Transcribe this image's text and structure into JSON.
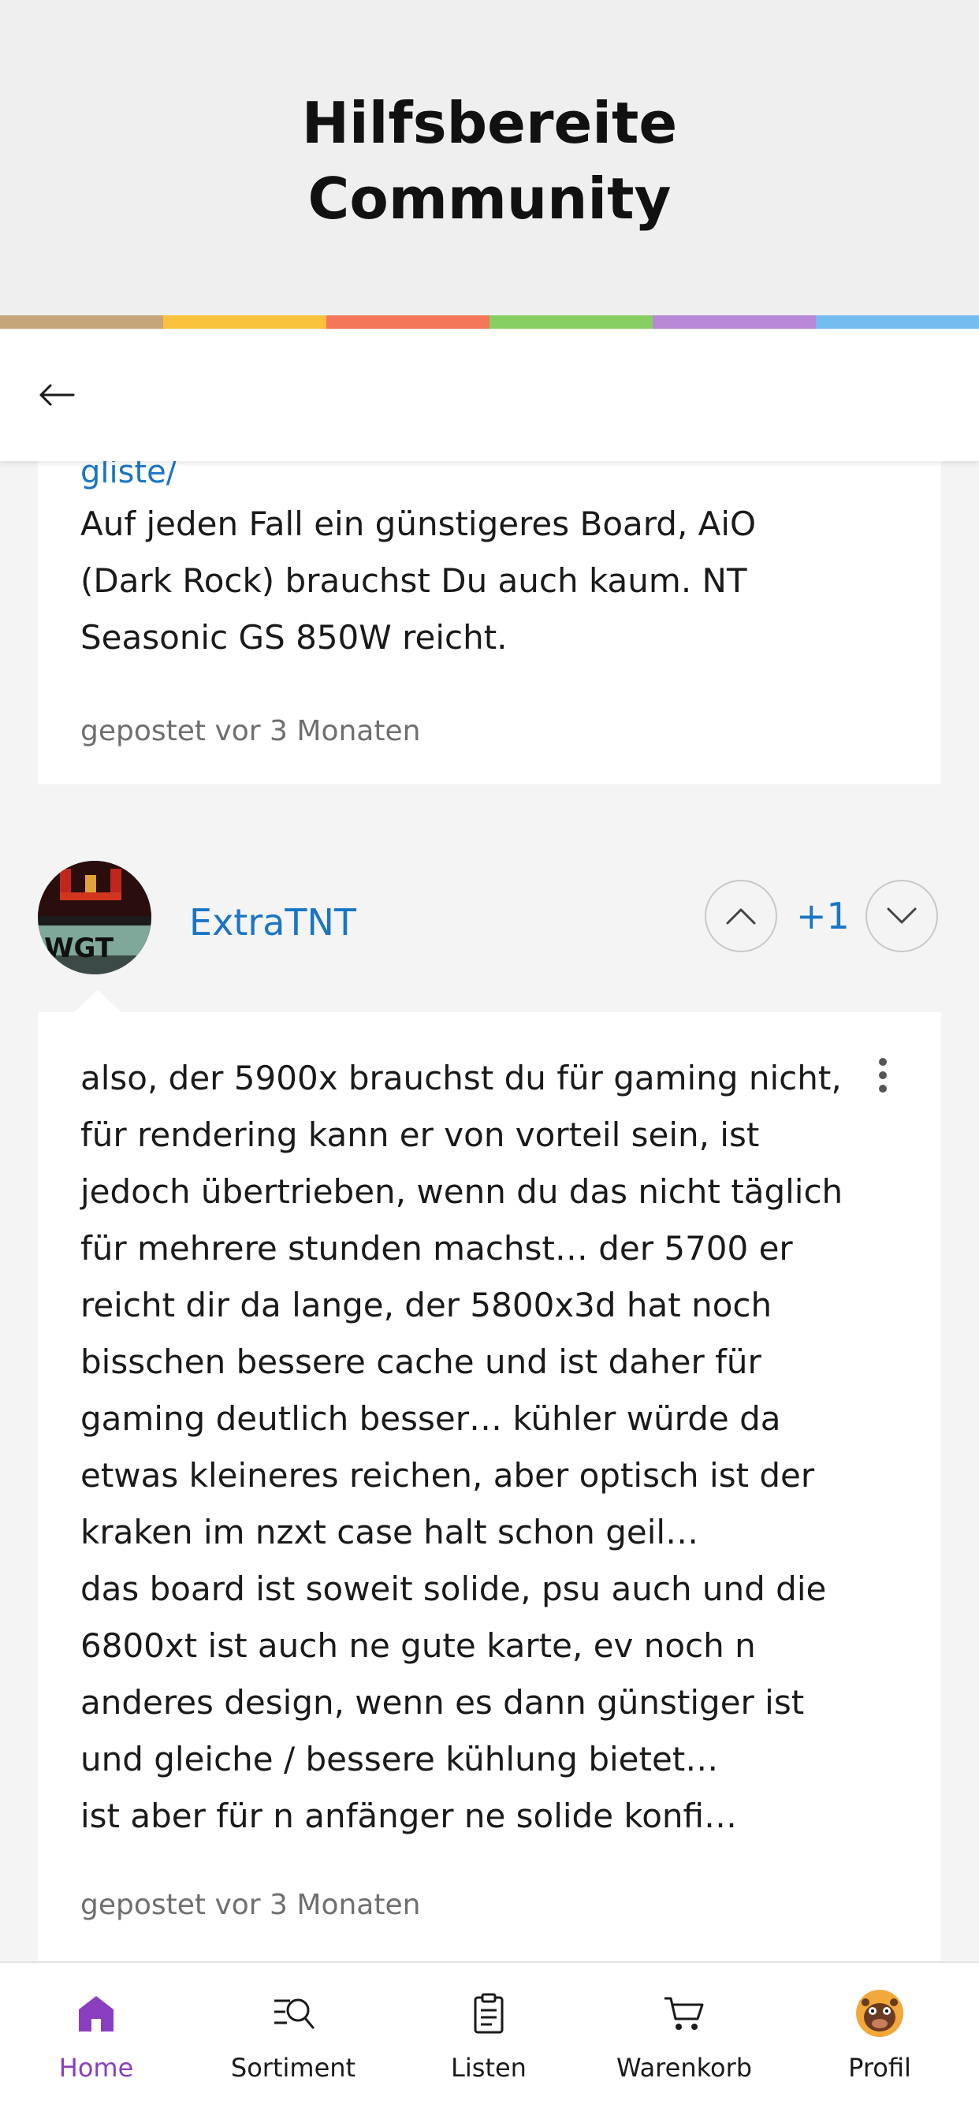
{
  "header": {
    "title_line1": "Hilfsbereite",
    "title_line2": "Community"
  },
  "stripe_colors": [
    "#c5a57a",
    "#f9c23c",
    "#f4775a",
    "#88cf63",
    "#b789d6",
    "#74bdf1"
  ],
  "post1": {
    "link_tail": "gliste/",
    "text": "Auf jeden Fall ein günstigeres Board, AiO\n(Dark Rock) brauchst Du auch kaum. NT\nSeasonic GS 850W reicht.",
    "meta": "gepostet vor 3 Monaten"
  },
  "post2": {
    "username": "ExtraTNT",
    "avatar_text": "WGT",
    "vote_count": "+1",
    "text": "also, der 5900x brauchst du für gaming nicht,\nfür rendering kann er von vorteil sein, ist\njedoch übertrieben, wenn du das nicht täglich\nfür mehrere stunden machst… der 5700 er\nreicht dir da lange, der 5800x3d hat noch\nbisschen bessere cache und ist daher für\ngaming deutlich besser… kühler würde da\netwas kleineres reichen, aber optisch ist der\nkraken im nzxt case halt schon geil…\ndas board ist soweit solide, psu auch und die\n6800xt ist auch ne gute karte, ev noch n\nanderes design, wenn es dann günstiger ist\nund gleiche / bessere kühlung bietet…\nist aber für n anfänger ne solide konfi…",
    "meta": "gepostet vor 3 Monaten"
  },
  "tabs": [
    {
      "label": "Home",
      "icon": "home-icon",
      "active": true
    },
    {
      "label": "Sortiment",
      "icon": "search-list-icon"
    },
    {
      "label": "Listen",
      "icon": "clipboard-icon"
    },
    {
      "label": "Warenkorb",
      "icon": "cart-icon"
    },
    {
      "label": "Profil",
      "icon": "profile-avatar-icon"
    }
  ],
  "colors": {
    "accent_link": "#1a75c4",
    "active_tab": "#8a3fc0"
  }
}
